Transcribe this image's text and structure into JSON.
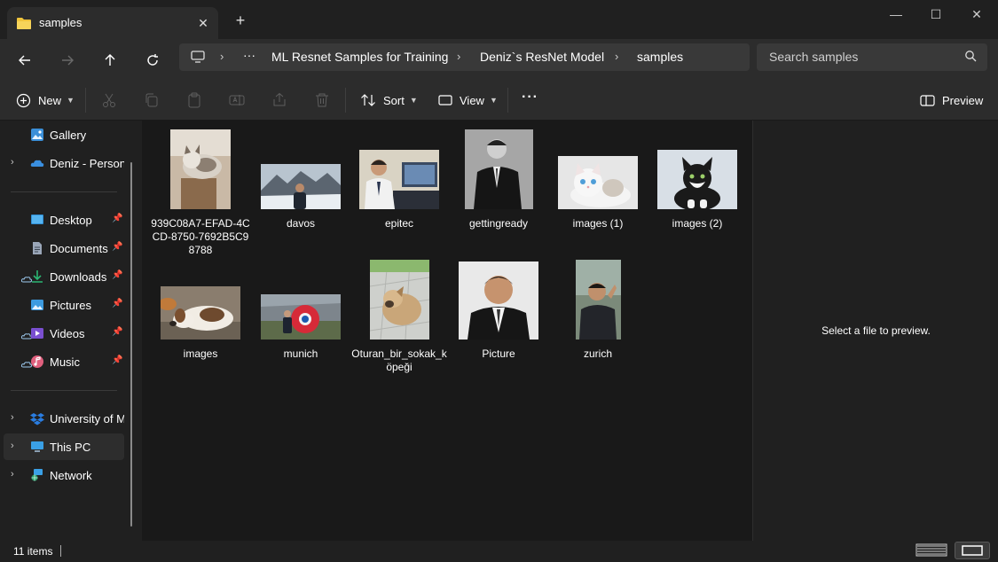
{
  "window": {
    "tab_title": "samples",
    "new_tab": "+",
    "minimize": "—",
    "maximize": "☐",
    "close": "✕"
  },
  "address": {
    "crumbs": [
      "ML Resnet Samples for Training",
      "Deniz`s ResNet Model",
      "samples"
    ],
    "ellipsis": "···"
  },
  "search": {
    "placeholder": "Search samples"
  },
  "toolbar": {
    "new_label": "New",
    "sort_label": "Sort",
    "view_label": "View",
    "more": "···",
    "preview_label": "Preview"
  },
  "sidebar": {
    "items": [
      {
        "label": "Gallery",
        "icon": "gallery-icon"
      },
      {
        "label": "Deniz - Personal",
        "icon": "onedrive-icon"
      },
      {
        "label": "Desktop",
        "icon": "desktop-icon",
        "pinned": true
      },
      {
        "label": "Documents",
        "icon": "documents-icon",
        "pinned": true
      },
      {
        "label": "Downloads",
        "icon": "downloads-icon",
        "pinned": true
      },
      {
        "label": "Pictures",
        "icon": "pictures-icon",
        "pinned": true
      },
      {
        "label": "Videos",
        "icon": "videos-icon",
        "pinned": true
      },
      {
        "label": "Music",
        "icon": "music-icon",
        "pinned": true
      },
      {
        "label": "University of Mi",
        "icon": "dropbox-icon"
      },
      {
        "label": "This PC",
        "icon": "pc-icon",
        "selected": true
      },
      {
        "label": "Network",
        "icon": "network-icon"
      }
    ]
  },
  "files": [
    {
      "name": "939C08A7-EFAD-4CCD-8750-7692B5C98788",
      "subject": "cat on scratching post"
    },
    {
      "name": "davos",
      "subject": "man in snowy mountains"
    },
    {
      "name": "epitec",
      "subject": "man at computer desk"
    },
    {
      "name": "gettingready",
      "subject": "black and white portrait in suit"
    },
    {
      "name": "images (1)",
      "subject": "white kitten"
    },
    {
      "name": "images (2)",
      "subject": "black and white kitten"
    },
    {
      "name": "images",
      "subject": "dog lying on ground"
    },
    {
      "name": "munich",
      "subject": "person with red ball"
    },
    {
      "name": "Oturan_bir_sokak_köpeği",
      "subject": "sitting street dog"
    },
    {
      "name": "Picture",
      "subject": "portrait in suit"
    },
    {
      "name": "zurich",
      "subject": "man outdoors"
    }
  ],
  "preview": {
    "message": "Select a file to preview."
  },
  "status": {
    "count": "11 items"
  },
  "colors": {
    "accent": "#4cc2ff",
    "folder": "#f0c43c"
  }
}
